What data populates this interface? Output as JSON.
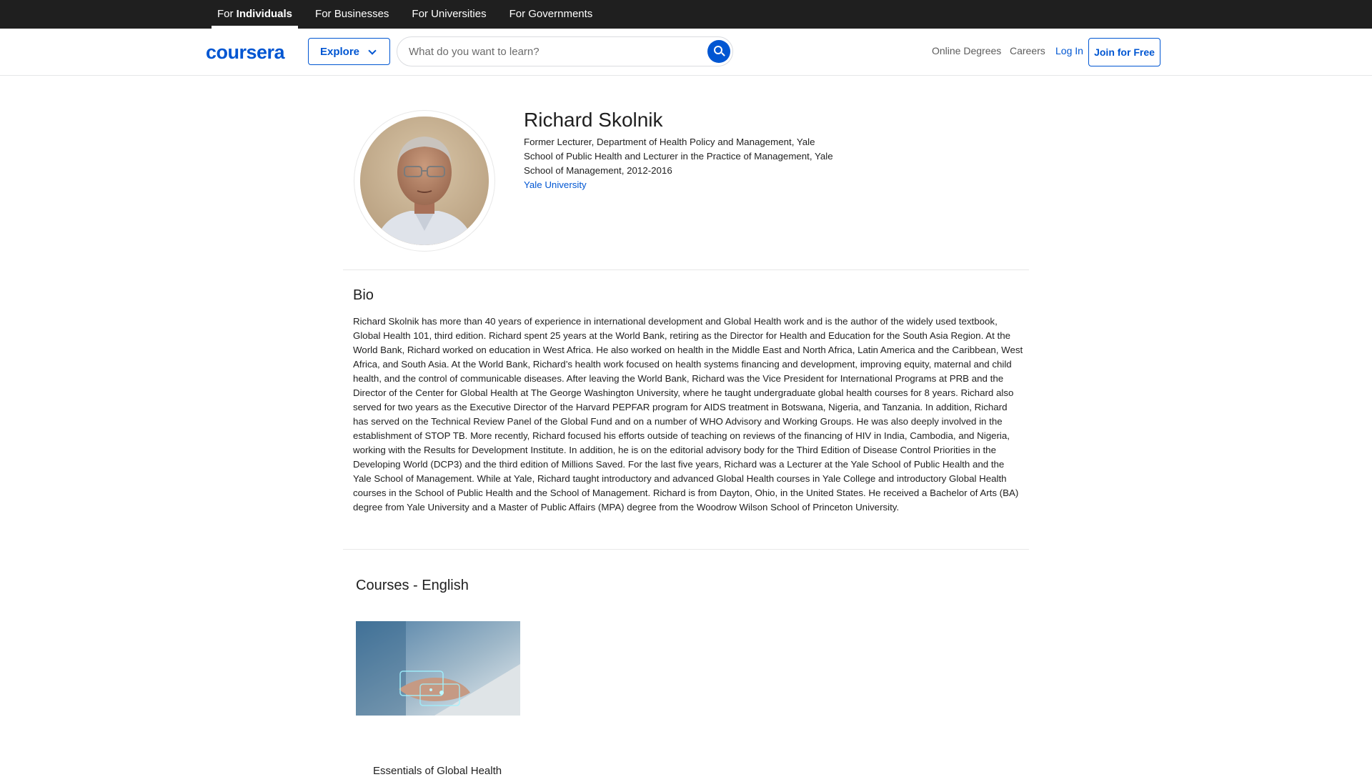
{
  "audience_bar": {
    "tabs": [
      {
        "prefix": "For ",
        "strong": "Individuals",
        "active": true
      },
      {
        "label": "For Businesses"
      },
      {
        "label": "For Universities"
      },
      {
        "label": "For Governments"
      }
    ]
  },
  "header": {
    "logo": "coursera",
    "explore_label": "Explore",
    "search_placeholder": "What do you want to learn?",
    "links": {
      "online_degrees": "Online Degrees",
      "careers": "Careers",
      "login": "Log In",
      "join": "Join for Free"
    }
  },
  "profile": {
    "name": "Richard Skolnik",
    "role": "Former Lecturer, Department of Health Policy and Management, Yale School of Public Health and Lecturer in the Practice of Management, Yale School of Management, 2012-2016",
    "affiliation": "Yale University"
  },
  "bio": {
    "title": "Bio",
    "text": "Richard Skolnik has more than 40 years of experience in international development and Global Health work and is the author of the widely used textbook, Global Health 101, third edition. Richard spent 25 years at the World Bank, retiring as the Director for Health and Education for the South Asia Region. At the World Bank, Richard worked on education in West Africa. He also worked on health in the Middle East and North Africa, Latin America and the Caribbean, West Africa, and South Asia. At the World Bank, Richard’s health work focused on health systems financing and development, improving equity, maternal and child health, and the control of communicable diseases. After leaving the World Bank, Richard was the Vice President for International Programs at PRB and the Director of the Center for Global Health at The George Washington University, where he taught undergraduate global health courses for 8 years. Richard also served for two years as the Executive Director of the Harvard PEPFAR program for AIDS treatment in Botswana, Nigeria, and Tanzania. In addition, Richard has served on the Technical Review Panel of the Global Fund and on a number of WHO Advisory and Working Groups. He was also deeply involved in the establishment of STOP TB. More recently, Richard focused his efforts outside of teaching on reviews of the financing of HIV in India, Cambodia, and Nigeria, working with the Results for Development Institute. In addition, he is on the editorial advisory body for the Third Edition of Disease Control Priorities in the Developing World (DCP3) and the third edition of Millions Saved. For the last five years, Richard was a Lecturer at the Yale School of Public Health and the Yale School of Management. While at Yale, Richard taught introductory and advanced Global Health courses in Yale College and introductory Global Health courses in the School of Public Health and the School of Management. Richard is from Dayton, Ohio, in the United States. He received a Bachelor of Arts (BA) degree from Yale University and a Master of Public Affairs (MPA) degree from the Woodrow Wilson School of Princeton University."
  },
  "courses": {
    "title": "Courses - English",
    "items": [
      {
        "title": "Essentials of Global Health"
      }
    ]
  },
  "icons": {
    "search": "search-icon",
    "explore_chevron": "chevron-down-icon"
  },
  "colors": {
    "brand": "#0056d2",
    "top_bar": "#1f1f1f"
  }
}
